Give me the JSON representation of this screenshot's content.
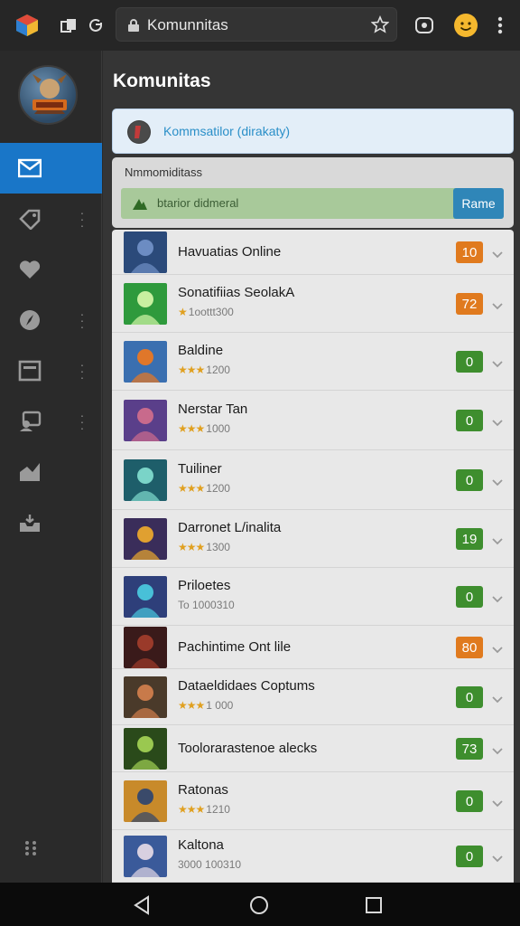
{
  "browser": {
    "url": "Komunnitas"
  },
  "page": {
    "title": "Komunitas",
    "info_text": "Kommsatilor (dirakaty)",
    "filter_label": "Nmmomiditass",
    "filter_text": "btarior didmeral",
    "filter_button": "Rame"
  },
  "colors": {
    "accent_blue": "#1976c8",
    "badge_orange": "#e07a1e",
    "badge_green": "#3e8e2e",
    "star_gold": "#e0a020"
  },
  "sidebar": {
    "items": [
      {
        "icon": "mail-icon",
        "active": true,
        "menu": false
      },
      {
        "icon": "tag-icon",
        "active": false,
        "menu": true
      },
      {
        "icon": "heart-icon",
        "active": false,
        "menu": false
      },
      {
        "icon": "compass-icon",
        "active": false,
        "menu": true
      },
      {
        "icon": "window-icon",
        "active": false,
        "menu": true
      },
      {
        "icon": "chat-user-icon",
        "active": false,
        "menu": true
      },
      {
        "icon": "trend-icon",
        "active": false,
        "menu": false
      },
      {
        "icon": "inbox-icon",
        "active": false,
        "menu": false
      }
    ]
  },
  "communities": [
    {
      "title": "Havuatias Online",
      "stars": "",
      "subtitle": "",
      "badge": "10",
      "badge_color": "orange"
    },
    {
      "title": "Sonatifiias SeolakA",
      "stars": "★",
      "subtitle": "1oottt300",
      "badge": "72",
      "badge_color": "orange"
    },
    {
      "title": "Baldine",
      "stars": "★★★",
      "subtitle": "1200",
      "badge": "0",
      "badge_color": "green"
    },
    {
      "title": "Nerstar Tan",
      "stars": "★★★",
      "subtitle": "1000",
      "badge": "0",
      "badge_color": "green"
    },
    {
      "title": "Tuiliner",
      "stars": "★★★",
      "subtitle": "1200",
      "badge": "0",
      "badge_color": "green"
    },
    {
      "title": "Darronet L/inalita",
      "stars": "★★★",
      "subtitle": "1300",
      "badge": "19",
      "badge_color": "green"
    },
    {
      "title": "Priloetes",
      "stars": "",
      "subtitle": "To 1000310",
      "badge": "0",
      "badge_color": "green"
    },
    {
      "title": "Pachintime Ont lile",
      "stars": "",
      "subtitle": "",
      "badge": "80",
      "badge_color": "orange"
    },
    {
      "title": "Dataeldidaes Coptums",
      "stars": "★★★",
      "subtitle": "1 000",
      "badge": "0",
      "badge_color": "green"
    },
    {
      "title": "Toolorarastenoe alecks",
      "stars": "",
      "subtitle": "",
      "badge": "73",
      "badge_color": "green"
    },
    {
      "title": "Ratonas",
      "stars": "★★★",
      "subtitle": "1210",
      "badge": "0",
      "badge_color": "green"
    },
    {
      "title": "Kaltona",
      "stars": "",
      "subtitle": "3000 100310",
      "badge": "0",
      "badge_color": "green"
    }
  ]
}
